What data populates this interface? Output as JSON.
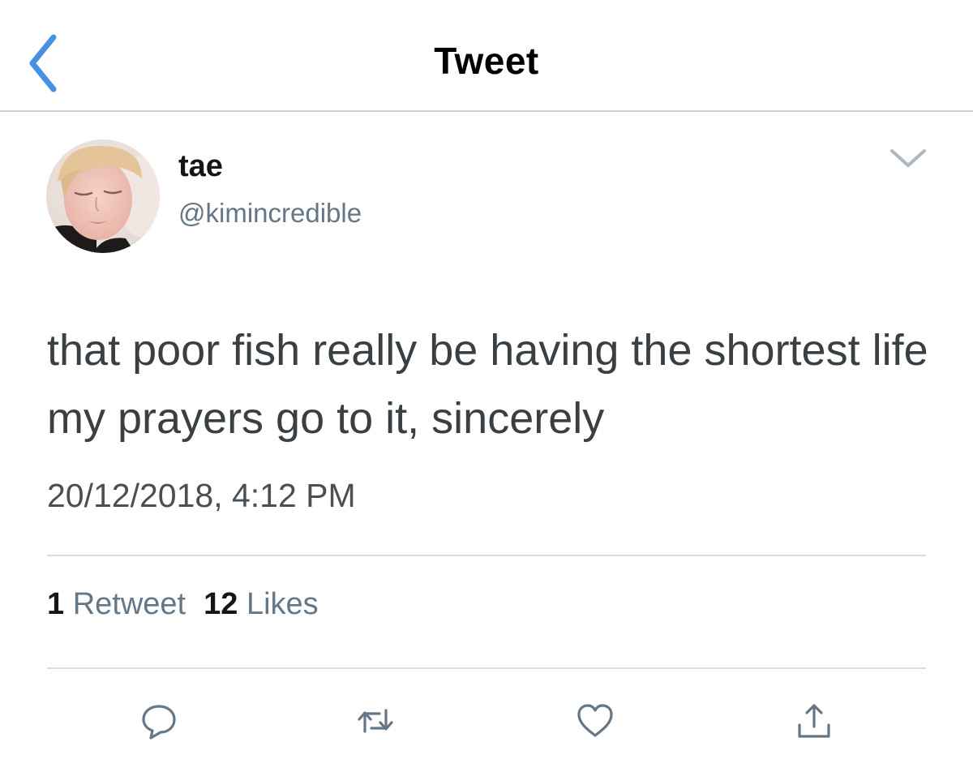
{
  "nav": {
    "title": "Tweet",
    "back_icon": "chevron-left-icon"
  },
  "tweet": {
    "author": {
      "display_name": "tae",
      "handle": "@kimincredible"
    },
    "text": "that poor fish really be having the shortest life my prayers go to it, sincerely",
    "timestamp": "20/12/2018, 4:12 PM",
    "stats": {
      "retweets_count": "1",
      "retweets_label": "Retweet",
      "likes_count": "12",
      "likes_label": "Likes"
    }
  },
  "actions": [
    {
      "name": "reply",
      "icon": "comment-icon"
    },
    {
      "name": "retweet",
      "icon": "retweet-icon"
    },
    {
      "name": "like",
      "icon": "heart-icon"
    },
    {
      "name": "share",
      "icon": "share-icon"
    }
  ],
  "colors": {
    "accent": "#4a90e2",
    "icon_gray": "#657786",
    "text_primary": "#14171a",
    "text_secondary": "#657786",
    "divider": "#d9dde0"
  }
}
